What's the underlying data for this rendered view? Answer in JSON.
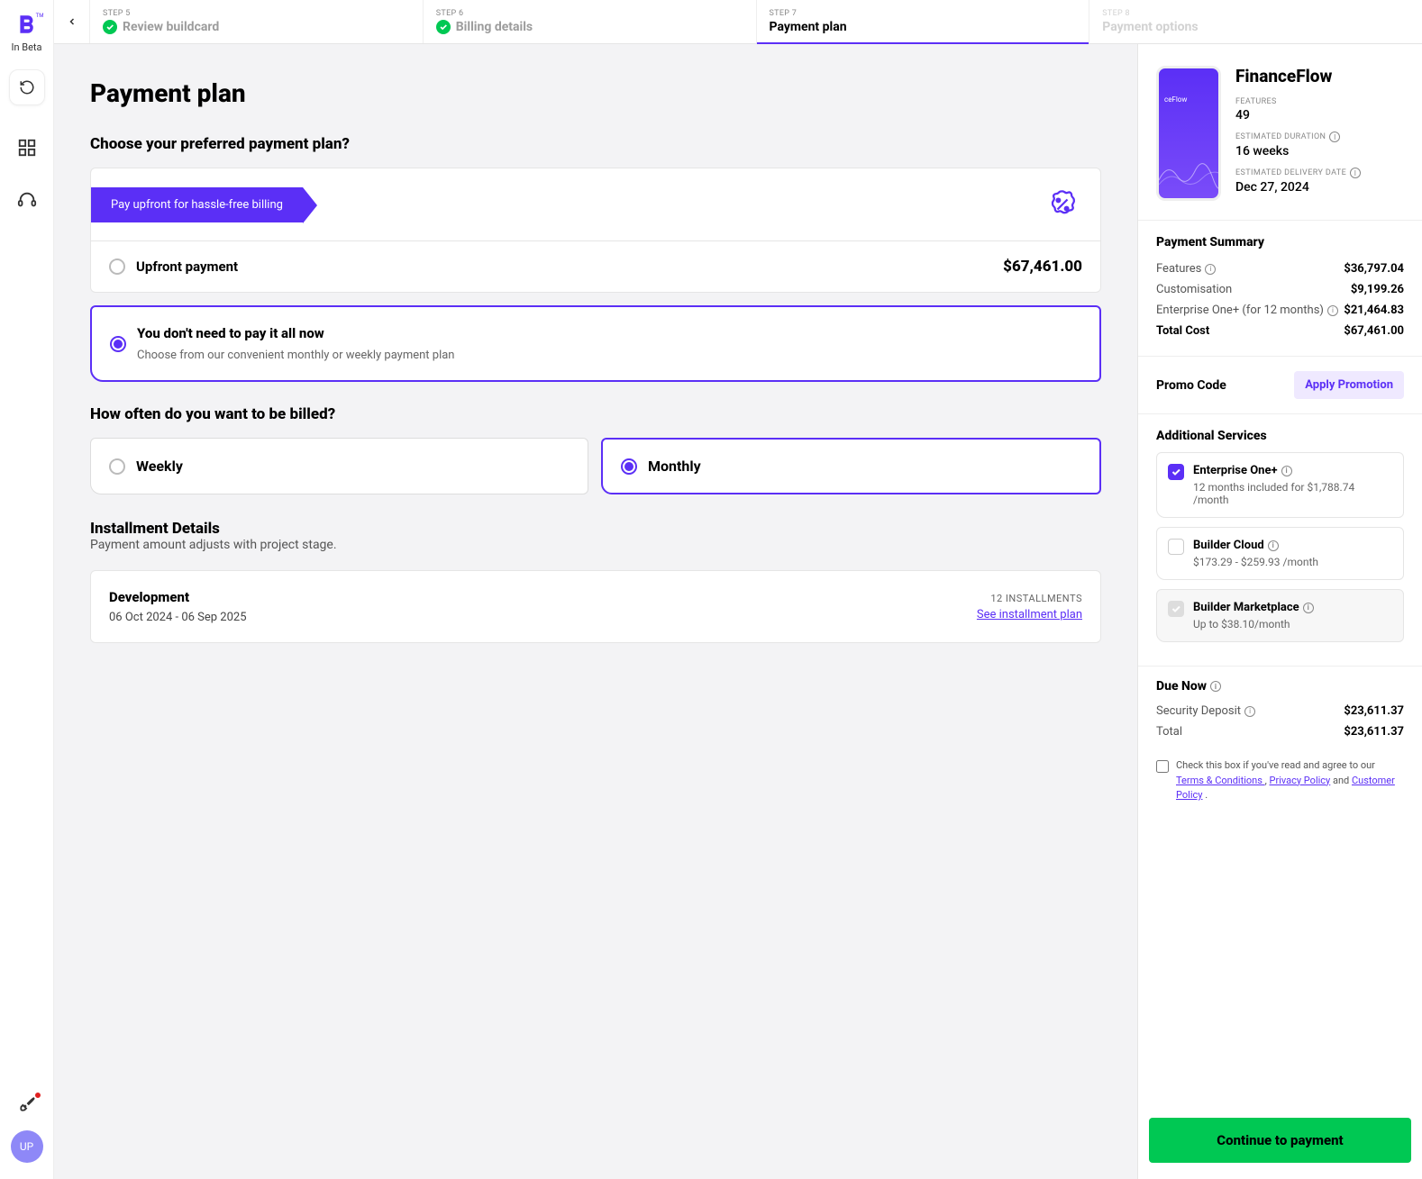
{
  "sidebar": {
    "beta_label": "In Beta",
    "avatar_initials": "UP"
  },
  "stepper": {
    "steps": [
      {
        "label": "STEP 5",
        "title": "Review buildcard",
        "state": "done"
      },
      {
        "label": "STEP 6",
        "title": "Billing details",
        "state": "done"
      },
      {
        "label": "STEP 7",
        "title": "Payment plan",
        "state": "current"
      },
      {
        "label": "STEP 8",
        "title": "Payment options",
        "state": "future"
      }
    ]
  },
  "page": {
    "heading": "Payment plan",
    "choose_heading": "Choose your preferred payment plan?",
    "ribbon": "Pay upfront for hassle-free billing",
    "upfront_label": "Upfront payment",
    "upfront_price": "$67,461.00",
    "installment_option_title": "You don't need to pay it all now",
    "installment_option_sub": "Choose from our convenient monthly or weekly payment plan",
    "freq_heading": "How often do you want to be billed?",
    "freq_weekly": "Weekly",
    "freq_monthly": "Monthly",
    "installment_heading": "Installment Details",
    "installment_sub": "Payment amount adjusts with project stage.",
    "dev_title": "Development",
    "dev_dates": "06 Oct 2024 - 06 Sep 2025",
    "dev_count": "12 INSTALLMENTS",
    "dev_link": "See installment plan"
  },
  "summary": {
    "app_name": "FinanceFlow",
    "preview_text": "ceFlow",
    "features_label": "FEATURES",
    "features_value": "49",
    "duration_label": "ESTIMATED DURATION",
    "duration_value": "16 weeks",
    "delivery_label": "ESTIMATED DELIVERY DATE",
    "delivery_value": "Dec 27, 2024",
    "payment_summary_title": "Payment Summary",
    "rows": {
      "features_label": "Features",
      "features_value": "$36,797.04",
      "custom_label": "Customisation",
      "custom_value": "$9,199.26",
      "enterprise_label": "Enterprise One+ (for 12 months)",
      "enterprise_value": "$21,464.83",
      "total_label": "Total Cost",
      "total_value": "$67,461.00"
    },
    "promo_label": "Promo Code",
    "promo_btn": "Apply Promotion",
    "additional_title": "Additional Services",
    "services": {
      "ent_title": "Enterprise One+",
      "ent_sub": "12 months included for $1,788.74 /month",
      "cloud_title": "Builder Cloud",
      "cloud_sub": "$173.29 - $259.93 /month",
      "market_title": "Builder Marketplace",
      "market_sub": "Up to $38.10/month"
    },
    "due_title": "Due Now",
    "deposit_label": "Security Deposit",
    "deposit_value": "$23,611.37",
    "due_total_label": "Total",
    "due_total_value": "$23,611.37",
    "terms_prefix": "Check this box if you've read and agree to our ",
    "terms_link": "Terms & Conditions ",
    "privacy_link": "Privacy Policy",
    "and_text": " and ",
    "customer_link": "Customer Policy",
    "comma": ", ",
    "period": " .",
    "cta": "Continue to payment"
  }
}
